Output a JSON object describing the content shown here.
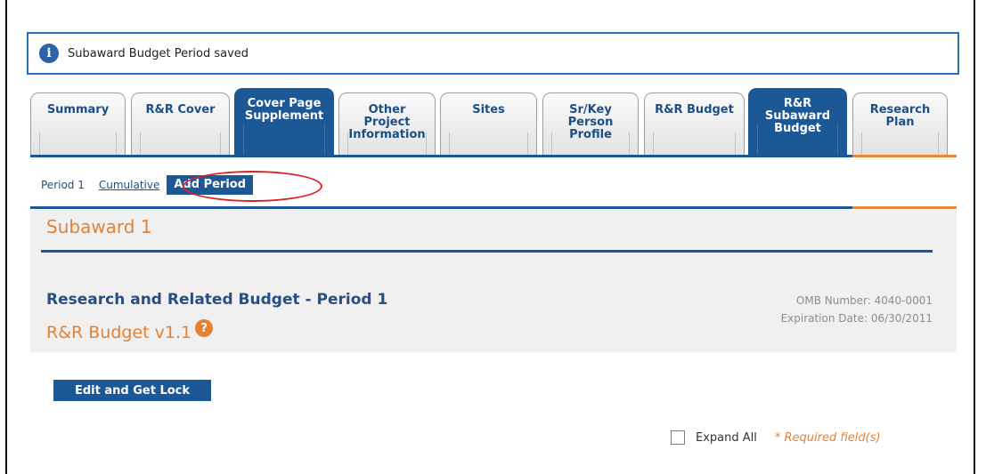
{
  "notice": {
    "text": "Subaward Budget Period saved",
    "icon": "info-icon"
  },
  "tabs": [
    {
      "label": "Summary",
      "active": false
    },
    {
      "label": "R&R Cover",
      "active": false
    },
    {
      "label": "Cover Page\nSupplement",
      "active": true
    },
    {
      "label": "Other\nProject\nInformation",
      "active": false
    },
    {
      "label": "Sites",
      "active": false
    },
    {
      "label": "Sr/Key\nPerson\nProfile",
      "active": false
    },
    {
      "label": "R&R Budget",
      "active": false
    },
    {
      "label": "R&R\nSubaward\nBudget",
      "active": true
    },
    {
      "label": "Research\nPlan",
      "active": false
    }
  ],
  "subnav": {
    "period": "Period 1",
    "cumulative": "Cumulative",
    "add_period": "Add Period"
  },
  "section": {
    "title": "Subaward 1",
    "heading": "Research and Related Budget - Period 1",
    "form_version": "R&R Budget v1.1",
    "omb_number": "OMB Number: 4040-0001",
    "expiration": "Expiration Date: 06/30/2011"
  },
  "actions": {
    "edit_lock": "Edit and Get Lock",
    "expand_all": "Expand All",
    "required": "* Required field(s)"
  },
  "colors": {
    "primary_blue": "#1d5896",
    "accent_orange": "#e28236",
    "highlight_red": "#d8232a"
  }
}
